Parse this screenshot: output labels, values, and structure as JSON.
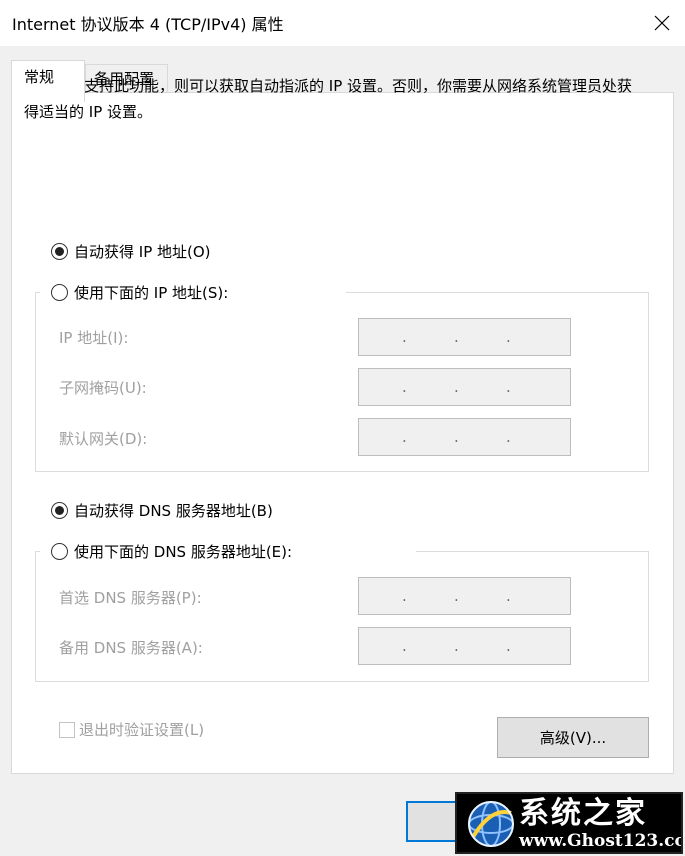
{
  "window": {
    "title": "Internet 协议版本 4 (TCP/IPv4) 属性",
    "close_icon": "close-icon"
  },
  "tabs": [
    {
      "label": "常规",
      "selected": true
    },
    {
      "label": "备用配置",
      "selected": false
    }
  ],
  "description": "如果网络支持此功能，则可以获取自动指派的 IP 设置。否则，你需要从网络系统管理员处获得适当的 IP 设置。",
  "ip": {
    "auto_label": "自动获得 IP 地址(O)",
    "auto_selected": true,
    "manual_label": "使用下面的 IP 地址(S):",
    "manual_selected": false,
    "fields": [
      {
        "label": "IP 地址(I):",
        "value": ". . ."
      },
      {
        "label": "子网掩码(U):",
        "value": ". . ."
      },
      {
        "label": "默认网关(D):",
        "value": ". . ."
      }
    ]
  },
  "dns": {
    "auto_label": "自动获得 DNS 服务器地址(B)",
    "auto_selected": true,
    "manual_label": "使用下面的 DNS 服务器地址(E):",
    "manual_selected": false,
    "fields": [
      {
        "label": "首选 DNS 服务器(P):",
        "value": ". . ."
      },
      {
        "label": "备用 DNS 服务器(A):",
        "value": ". . ."
      }
    ]
  },
  "validate_on_exit": {
    "label": "退出时验证设置(L)",
    "checked": false,
    "enabled": false
  },
  "buttons": {
    "advanced": "高级(V)..."
  },
  "watermark": {
    "title": "系统之家",
    "url": "www.Ghost123.com"
  },
  "colors": {
    "focus_border": "#0078d7",
    "disabled_text": "#a0a0a0",
    "client_bg": "#f0f0f0"
  }
}
